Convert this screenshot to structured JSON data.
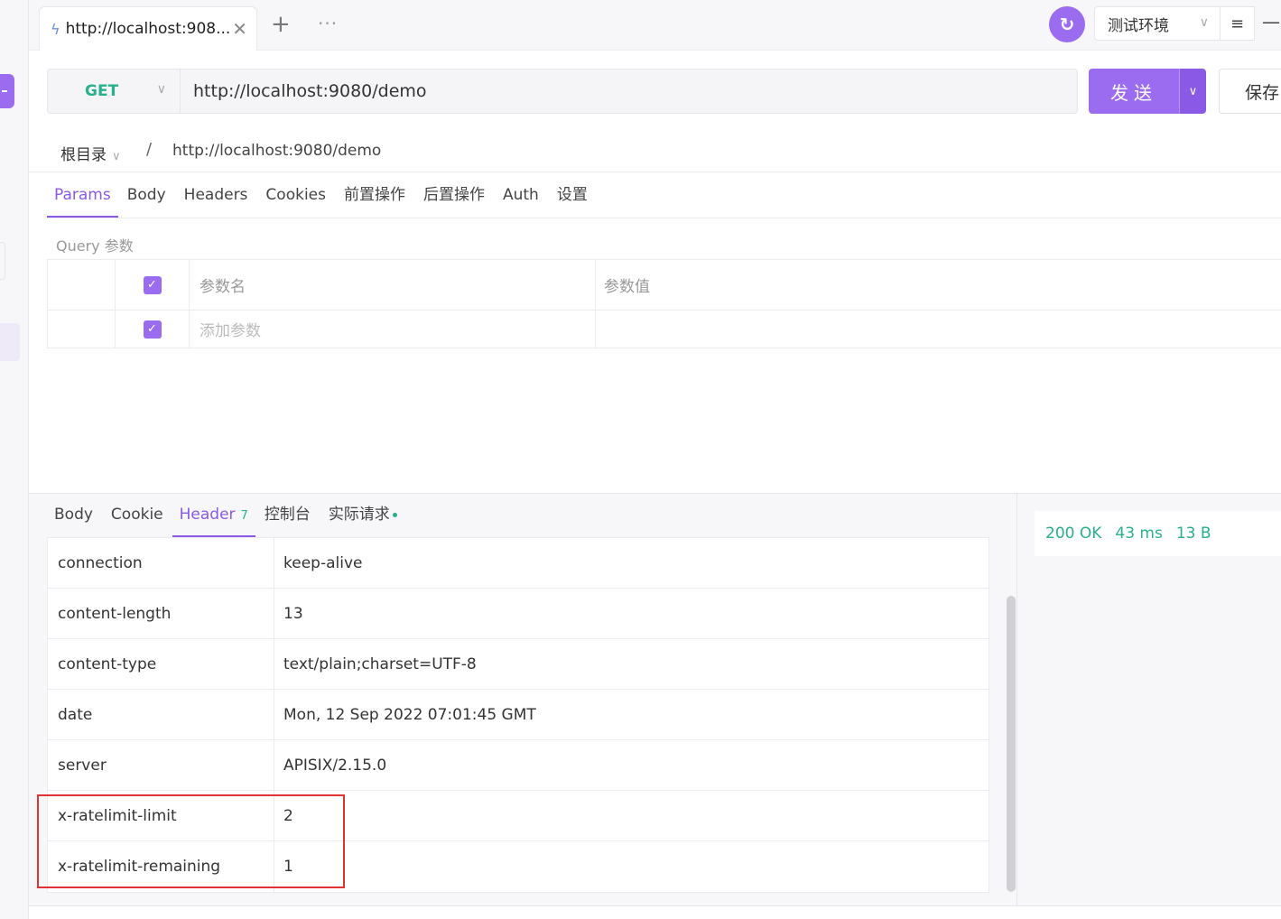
{
  "tabbar": {
    "tab_title": "http://localhost:908...",
    "add_label": "+",
    "more_label": "···",
    "env": "测试环境",
    "menu_icon": "≡",
    "minimize_icon": "—"
  },
  "request": {
    "method": "GET",
    "url": "http://localhost:9080/demo",
    "send_label": "发送",
    "save_label": "保存"
  },
  "breadcrumb": {
    "root": "根目录",
    "separator": "/",
    "path": "http://localhost:9080/demo"
  },
  "request_tabs": [
    "Params",
    "Body",
    "Headers",
    "Cookies",
    "前置操作",
    "后置操作",
    "Auth",
    "设置"
  ],
  "query": {
    "label": "Query 参数",
    "name_header": "参数名",
    "value_header": "参数值",
    "add_placeholder": "添加参数"
  },
  "response_tabs": {
    "body": "Body",
    "cookie": "Cookie",
    "header": "Header",
    "header_count": "7",
    "console": "控制台",
    "actual": "实际请求"
  },
  "headers": [
    {
      "key": "connection",
      "value": "keep-alive"
    },
    {
      "key": "content-length",
      "value": "13"
    },
    {
      "key": "content-type",
      "value": "text/plain;charset=UTF-8"
    },
    {
      "key": "date",
      "value": "Mon, 12 Sep 2022 07:01:45 GMT"
    },
    {
      "key": "server",
      "value": "APISIX/2.15.0"
    },
    {
      "key": "x-ratelimit-limit",
      "value": "2"
    },
    {
      "key": "x-ratelimit-remaining",
      "value": "1"
    }
  ],
  "status": {
    "code": "200 OK",
    "time": "43 ms",
    "size": "13 B"
  },
  "colors": {
    "accent": "#9b6cf0",
    "success": "#27b08a",
    "highlight": "#e03232"
  }
}
